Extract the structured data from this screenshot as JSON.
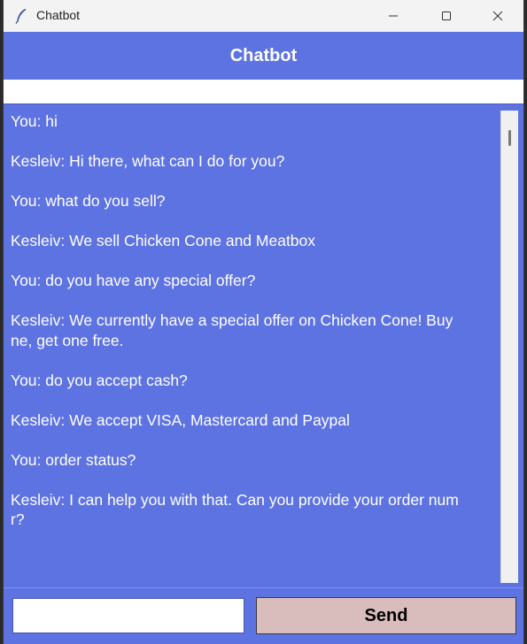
{
  "window": {
    "title": "Chatbot"
  },
  "header": {
    "title": "Chatbot"
  },
  "chat": {
    "transcript": "You: hi\n\nKesleiv: Hi there, what can I do for you?\n\nYou: what do you sell?\n\nKesleiv: We sell Chicken Cone and Meatbox\n\nYou: do you have any special offer?\n\nKesleiv: We currently have a special offer on Chicken Cone! Buy\nne, get one free.\n\nYou: do you accept cash?\n\nKesleiv: We accept VISA, Mastercard and Paypal\n\nYou: order status?\n\nKesleiv: I can help you with that. Can you provide your order num\nr?"
  },
  "input": {
    "value": "",
    "placeholder": ""
  },
  "send_button": {
    "label": "Send"
  },
  "colors": {
    "accent": "#5e73e2",
    "send_button": "#d9bcbc",
    "text": "#ffffff"
  },
  "icons": {
    "app": "feather-icon",
    "minimize": "minimize-icon",
    "maximize": "maximize-icon",
    "close": "close-icon"
  }
}
